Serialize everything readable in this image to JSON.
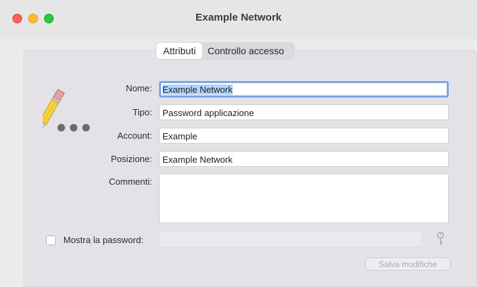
{
  "window": {
    "title": "Example Network"
  },
  "tabs": [
    {
      "label": "Attributi",
      "selected": true
    },
    {
      "label": "Controllo accesso",
      "selected": false
    }
  ],
  "form": {
    "name_label": "Nome:",
    "name_value": "Example Network",
    "type_label": "Tipo:",
    "type_value": "Password applicazione",
    "account_label": "Account:",
    "account_value": "Example",
    "position_label": "Posizione:",
    "position_value": "Example Network",
    "comments_label": "Commenti:",
    "comments_value": "",
    "show_password_label": "Mostra la password:",
    "show_password_checked": false,
    "password_value": "",
    "save_label": "Salva modifiche"
  },
  "icons": {
    "app_icon": "pencil-with-dots-icon",
    "key": "key-icon"
  },
  "colors": {
    "close": "#fe5f57",
    "minimize": "#febc2e",
    "maximize": "#28c840",
    "focus_ring": "#7aa6e3",
    "selection": "#b3d4fd"
  }
}
